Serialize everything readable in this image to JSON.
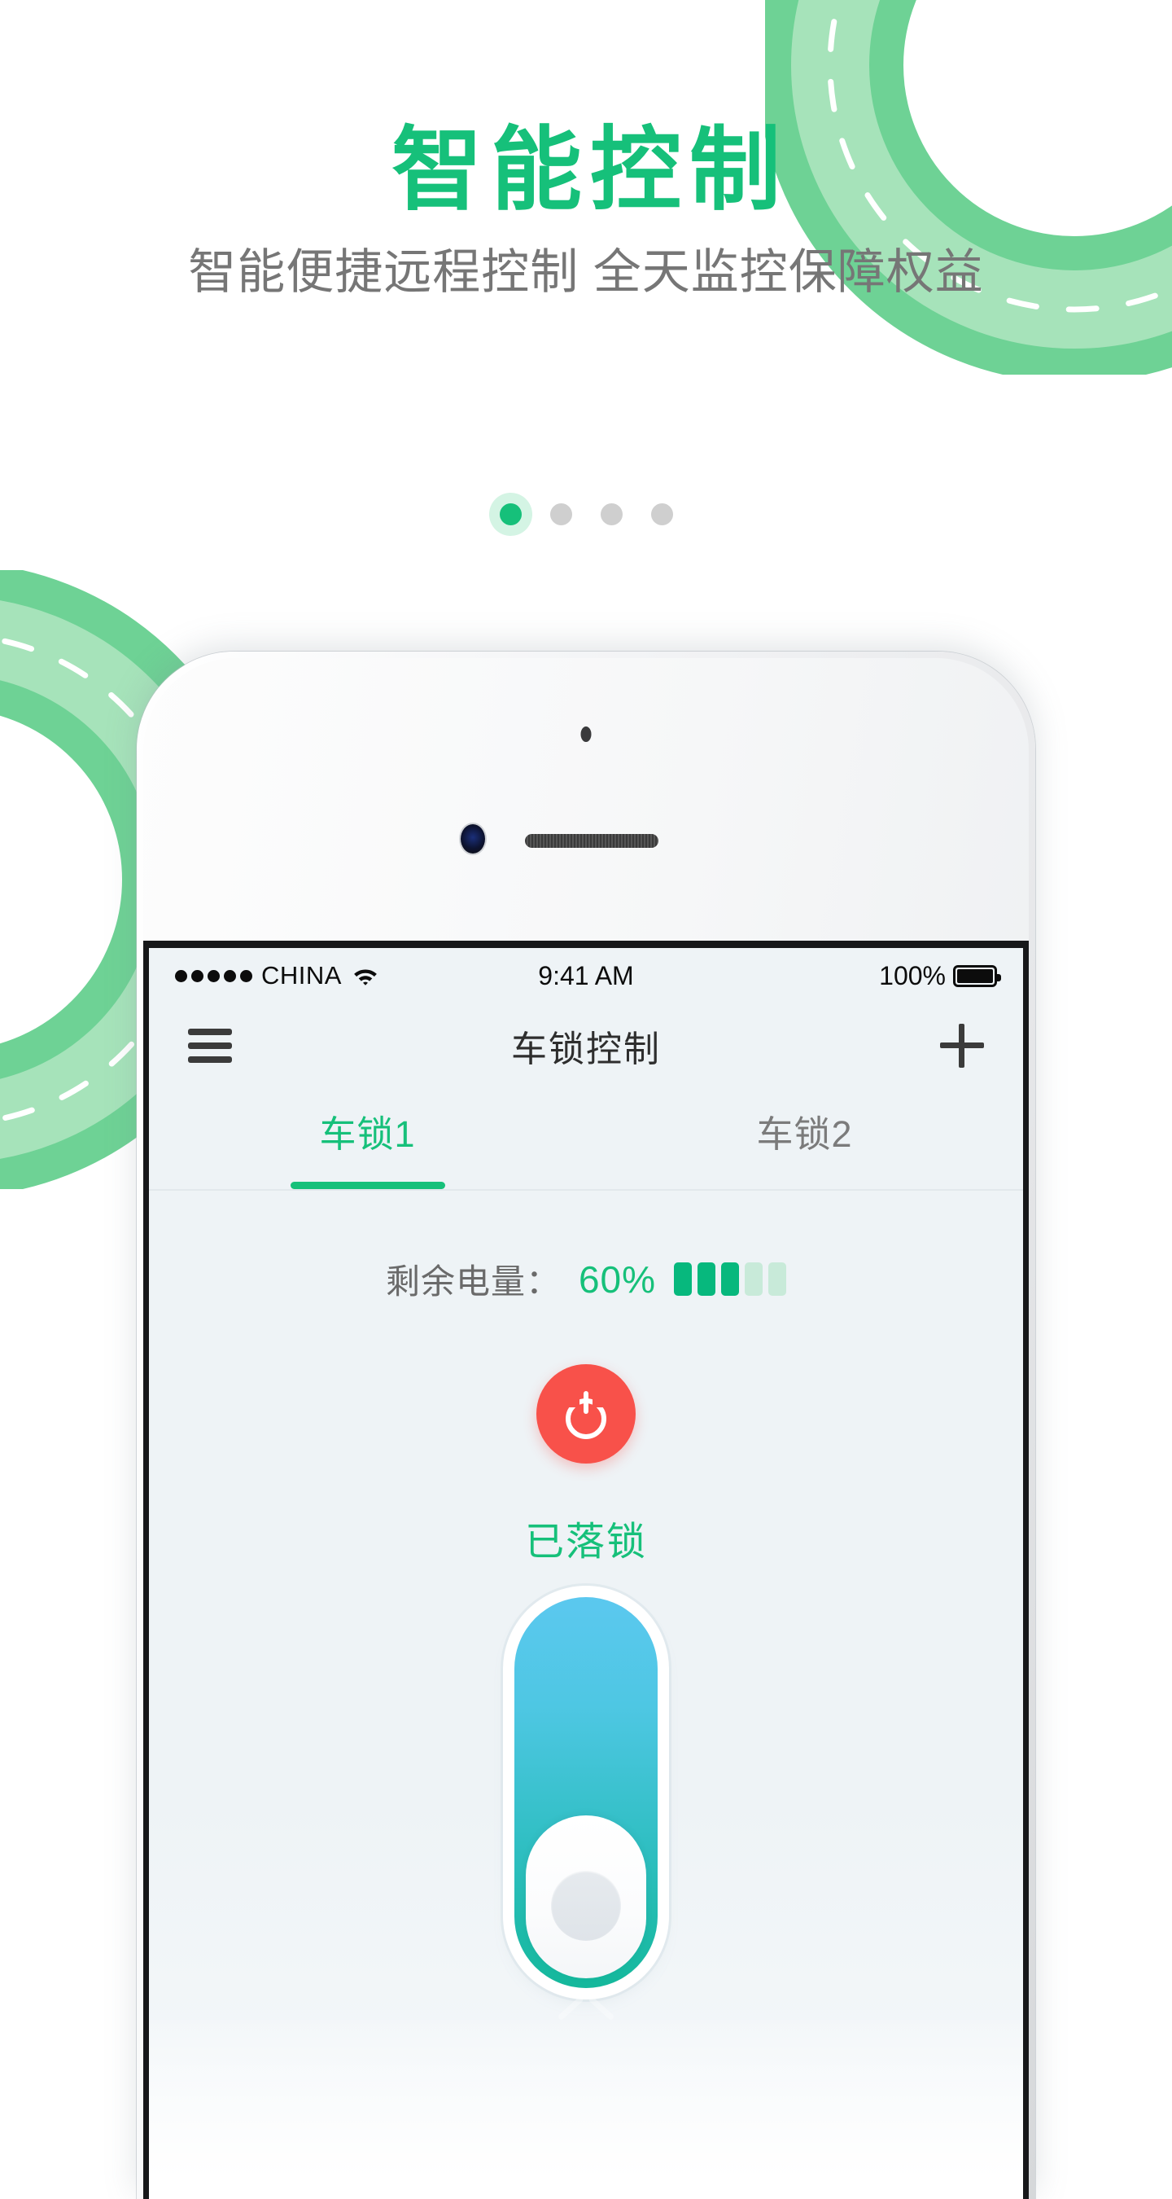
{
  "hero": {
    "title": "智能控制",
    "subtitle": "智能便捷远程控制  全天监控保障权益",
    "title_color": "#16c07a",
    "subtitle_color": "#767676"
  },
  "pager": {
    "dots": [
      "active",
      "inactive",
      "inactive",
      "inactive"
    ],
    "active_index": 0,
    "active_color": "#16c07a",
    "inactive_color": "#cfcfcf",
    "halo_color": "#d4f4e4"
  },
  "phone": {
    "statusbar": {
      "signal_dots": 5,
      "carrier": "CHINA",
      "wifi_icon": "wifi-icon",
      "time": "9:41 AM",
      "battery_percent": "100%",
      "battery_icon": "battery-full-icon"
    },
    "navbar": {
      "menu_icon": "hamburger-menu-icon",
      "title": "车锁控制",
      "add_icon": "plus-icon"
    },
    "tabs": [
      {
        "label": "车锁1",
        "active": true
      },
      {
        "label": "车锁2",
        "active": false
      }
    ],
    "content": {
      "battery_label": "剩余电量：",
      "battery_value": "60%",
      "battery_bars_total": 5,
      "battery_bars_filled": 3,
      "battery_bar_on_color": "#07b87d",
      "battery_bar_off_color": "#c8ead9",
      "power_button": {
        "icon": "power-icon",
        "color": "#f8514a"
      },
      "lock_status": "已落锁",
      "lock_status_color": "#16c07a",
      "slider": {
        "name": "unlock-slider",
        "knob_position": "bottom",
        "gradient_top": "#5bc8ef",
        "gradient_bottom": "#14b89b",
        "hint_icon": "chevron-up-icon"
      }
    }
  },
  "decoration": {
    "road_dark": "#6ed295",
    "road_light": "#a6e3ba",
    "road_dash": "#ffffff"
  }
}
